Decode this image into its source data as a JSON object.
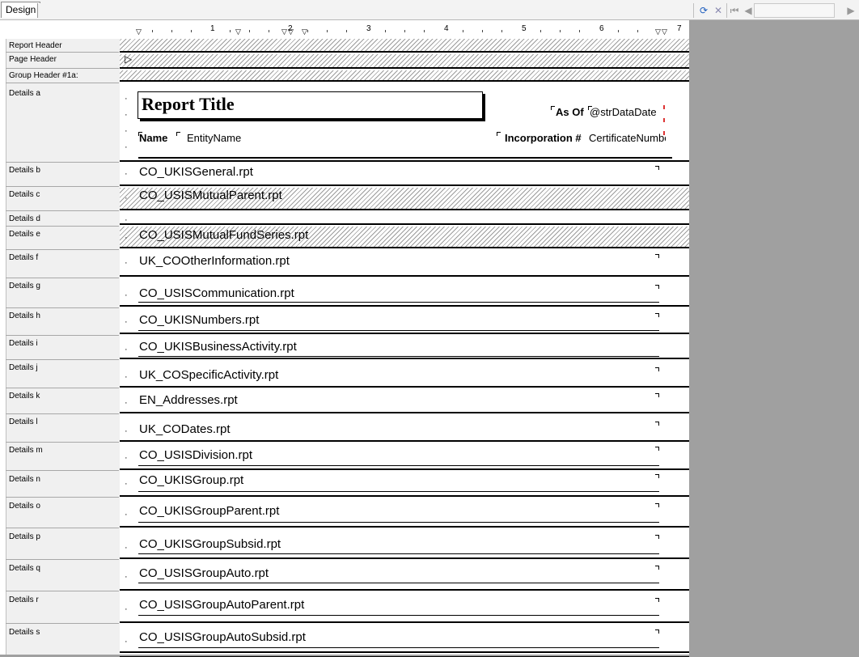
{
  "toolbar": {
    "design_tab": "Design",
    "icons": [
      "refresh-icon",
      "stop-icon",
      "first-page-icon",
      "previous-page-icon",
      "next-page-icon"
    ]
  },
  "ruler": {
    "numbers": [
      "1",
      "2",
      "3",
      "4",
      "5",
      "6",
      "7"
    ]
  },
  "sections": [
    {
      "label": "Report Header"
    },
    {
      "label": "Page Header"
    },
    {
      "label": "Group Header #1a:"
    },
    {
      "label": "Details a"
    },
    {
      "label": "Details b"
    },
    {
      "label": "Details c"
    },
    {
      "label": "Details d"
    },
    {
      "label": "Details e"
    },
    {
      "label": "Details f"
    },
    {
      "label": "Details g"
    },
    {
      "label": "Details h"
    },
    {
      "label": "Details i"
    },
    {
      "label": "Details j"
    },
    {
      "label": "Details k"
    },
    {
      "label": "Details l"
    },
    {
      "label": "Details m"
    },
    {
      "label": "Details n"
    },
    {
      "label": "Details o"
    },
    {
      "label": "Details p"
    },
    {
      "label": "Details q"
    },
    {
      "label": "Details r"
    },
    {
      "label": "Details s"
    }
  ],
  "details_a": {
    "report_title": "Report Title",
    "as_of_label": "As Of",
    "data_date_field": "@strDataDate",
    "name_label": "Name",
    "entity_name_field": "EntityName",
    "incorporation_label": "Incorporation #",
    "certificate_field": "CertificateNumbe"
  },
  "subreports": [
    "CO_UKISGeneral.rpt",
    "CO_USISMutualParent.rpt",
    "CO_USISMutualFundSeries.rpt",
    "UK_COOtherInformation.rpt",
    "CO_USISCommunication.rpt",
    "CO_UKISNumbers.rpt",
    "CO_UKISBusinessActivity.rpt",
    "UK_COSpecificActivity.rpt",
    "EN_Addresses.rpt",
    "UK_CODates.rpt",
    "CO_USISDivision.rpt",
    "CO_UKISGroup.rpt",
    "CO_UKISGroupParent.rpt",
    "CO_UKISGroupSubsid.rpt",
    "CO_USISGroupAuto.rpt",
    "CO_USISGroupAutoParent.rpt",
    "CO_USISGroupAutoSubsid.rpt"
  ]
}
